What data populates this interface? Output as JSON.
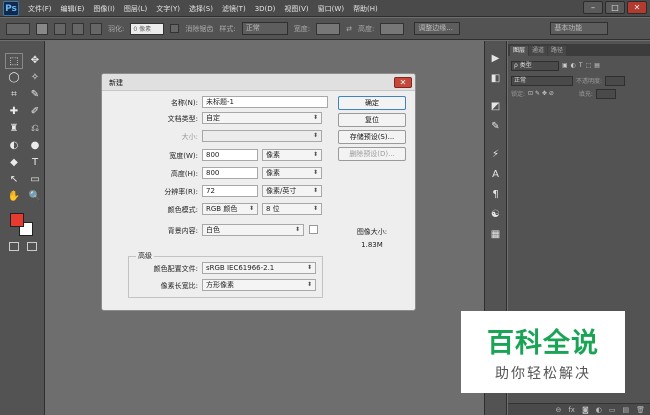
{
  "app": {
    "logo": "Ps"
  },
  "menu": [
    "文件(F)",
    "编辑(E)",
    "图像(I)",
    "图层(L)",
    "文字(Y)",
    "选择(S)",
    "滤镜(T)",
    "3D(D)",
    "视图(V)",
    "窗口(W)",
    "帮助(H)"
  ],
  "window_controls": {
    "minimize": "–",
    "restore": "□",
    "close": "✕"
  },
  "options": {
    "feather_label": "羽化:",
    "feather_value": "0 像素",
    "antialias_label": "消除锯齿",
    "style_label": "样式:",
    "style_value": "正常",
    "width_label": "宽度:",
    "height_label": "高度:",
    "refine_edge": "调整边缘...",
    "workspace": "基本功能"
  },
  "tools_left": [
    "⬚",
    "✥",
    "◯",
    "✧",
    "⌗",
    "✎",
    "✚",
    "✐",
    "♜",
    "⎌",
    "◐",
    "●",
    "◆",
    "T",
    "↖",
    "▭",
    "✋",
    "🔍"
  ],
  "tools_right": [
    "▶",
    "◧",
    "◩",
    "✎",
    "⚡",
    "A",
    "¶",
    "☯",
    "▦"
  ],
  "panel": {
    "tabs": [
      "图层",
      "通道",
      "路径"
    ],
    "kind_label": "ρ 类型",
    "blend": "正常",
    "opacity_label": "不透明度:",
    "lock_label": "锁定:",
    "fill_label": "填充:",
    "footer_icons": [
      "⊖",
      "fx",
      "◙",
      "◐",
      "▭",
      "▤",
      "🗑"
    ]
  },
  "dialog": {
    "title": "新建",
    "close": "✕",
    "name_label": "名称(N):",
    "name_value": "未标题-1",
    "doc_type_label": "文档类型:",
    "doc_type_value": "自定",
    "size_label": "大小:",
    "width_label": "宽度(W):",
    "width_value": "800",
    "width_unit": "像素",
    "height_label": "高度(H):",
    "height_value": "800",
    "height_unit": "像素",
    "res_label": "分辨率(R):",
    "res_value": "72",
    "res_unit": "像素/英寸",
    "mode_label": "颜色模式:",
    "mode_value": "RGB 颜色",
    "bits_value": "8 位",
    "bg_label": "背景内容:",
    "bg_value": "白色",
    "advanced": "高级",
    "profile_label": "颜色配置文件:",
    "profile_value": "sRGB IEC61966-2.1",
    "aspect_label": "像素长宽比:",
    "aspect_value": "方形像素",
    "ok": "确定",
    "reset": "复位",
    "save_preset": "存储预设(S)...",
    "delete_preset": "删除预设(D)...",
    "image_size_label": "图像大小:",
    "image_size_value": "1.83M"
  },
  "watermark": {
    "title": "百科全说",
    "subtitle": "助你轻松解决"
  },
  "colors": {
    "foreground": "#e63b2e",
    "background": "#ffffff",
    "ok_border": "#3f82c6",
    "watermark_green": "#1aa455"
  }
}
